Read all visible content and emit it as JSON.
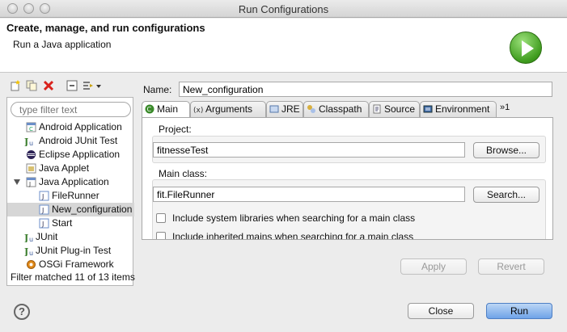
{
  "window": {
    "title": "Run Configurations"
  },
  "header": {
    "title": "Create, manage, and run configurations",
    "subtitle": "Run a Java application",
    "icon": "run-icon"
  },
  "left_toolbar": {
    "icons": [
      "new-configuration-icon",
      "duplicate-icon",
      "delete-icon",
      "collapse-all-icon",
      "filter-icon",
      "dropdown-arrow-icon"
    ]
  },
  "filter": {
    "placeholder": "type filter text",
    "status": "Filter matched 11 of 13 items"
  },
  "tree": {
    "items": [
      {
        "label": "Android Application",
        "icon": "android-app-icon",
        "level": 0
      },
      {
        "label": "Android JUnit Test",
        "icon": "junit-icon",
        "level": 0
      },
      {
        "label": "Eclipse Application",
        "icon": "eclipse-icon",
        "level": 0
      },
      {
        "label": "Java Applet",
        "icon": "java-applet-icon",
        "level": 0
      },
      {
        "label": "Java Application",
        "icon": "java-app-icon",
        "level": 0,
        "expanded": true
      },
      {
        "label": "FileRunner",
        "icon": "java-config-icon",
        "level": 1
      },
      {
        "label": "New_configuration",
        "icon": "java-config-icon",
        "level": 1,
        "selected": true
      },
      {
        "label": "Start",
        "icon": "java-config-icon",
        "level": 1
      },
      {
        "label": "JUnit",
        "icon": "junit-icon",
        "level": 0
      },
      {
        "label": "JUnit Plug-in Test",
        "icon": "junit-plugin-icon",
        "level": 0
      },
      {
        "label": "OSGi Framework",
        "icon": "osgi-icon",
        "level": 0
      }
    ]
  },
  "name": {
    "label": "Name:",
    "value": "New_configuration"
  },
  "tabs": [
    {
      "label": "Main",
      "icon": "main-tab-icon",
      "active": true
    },
    {
      "label": "Arguments",
      "icon": "arguments-icon"
    },
    {
      "label": "JRE",
      "icon": "jre-icon"
    },
    {
      "label": "Classpath",
      "icon": "classpath-icon"
    },
    {
      "label": "Source",
      "icon": "source-icon"
    },
    {
      "label": "Environment",
      "icon": "environment-icon"
    }
  ],
  "tab_overflow": "»1",
  "main": {
    "project_label": "Project:",
    "project_value": "fitnesseTest",
    "browse_label": "Browse...",
    "main_class_label": "Main class:",
    "main_class_value": "fit.FileRunner",
    "search_label": "Search...",
    "include_system_libs": "Include system libraries when searching for a main class",
    "include_inherited": "Include inherited mains when searching for a main class"
  },
  "actions": {
    "apply": "Apply",
    "revert": "Revert",
    "close": "Close",
    "run": "Run"
  },
  "colors": {
    "run_button": "#6fa3e8",
    "selection": "#d6d6d6",
    "run_icon": "#3f9c1e"
  }
}
